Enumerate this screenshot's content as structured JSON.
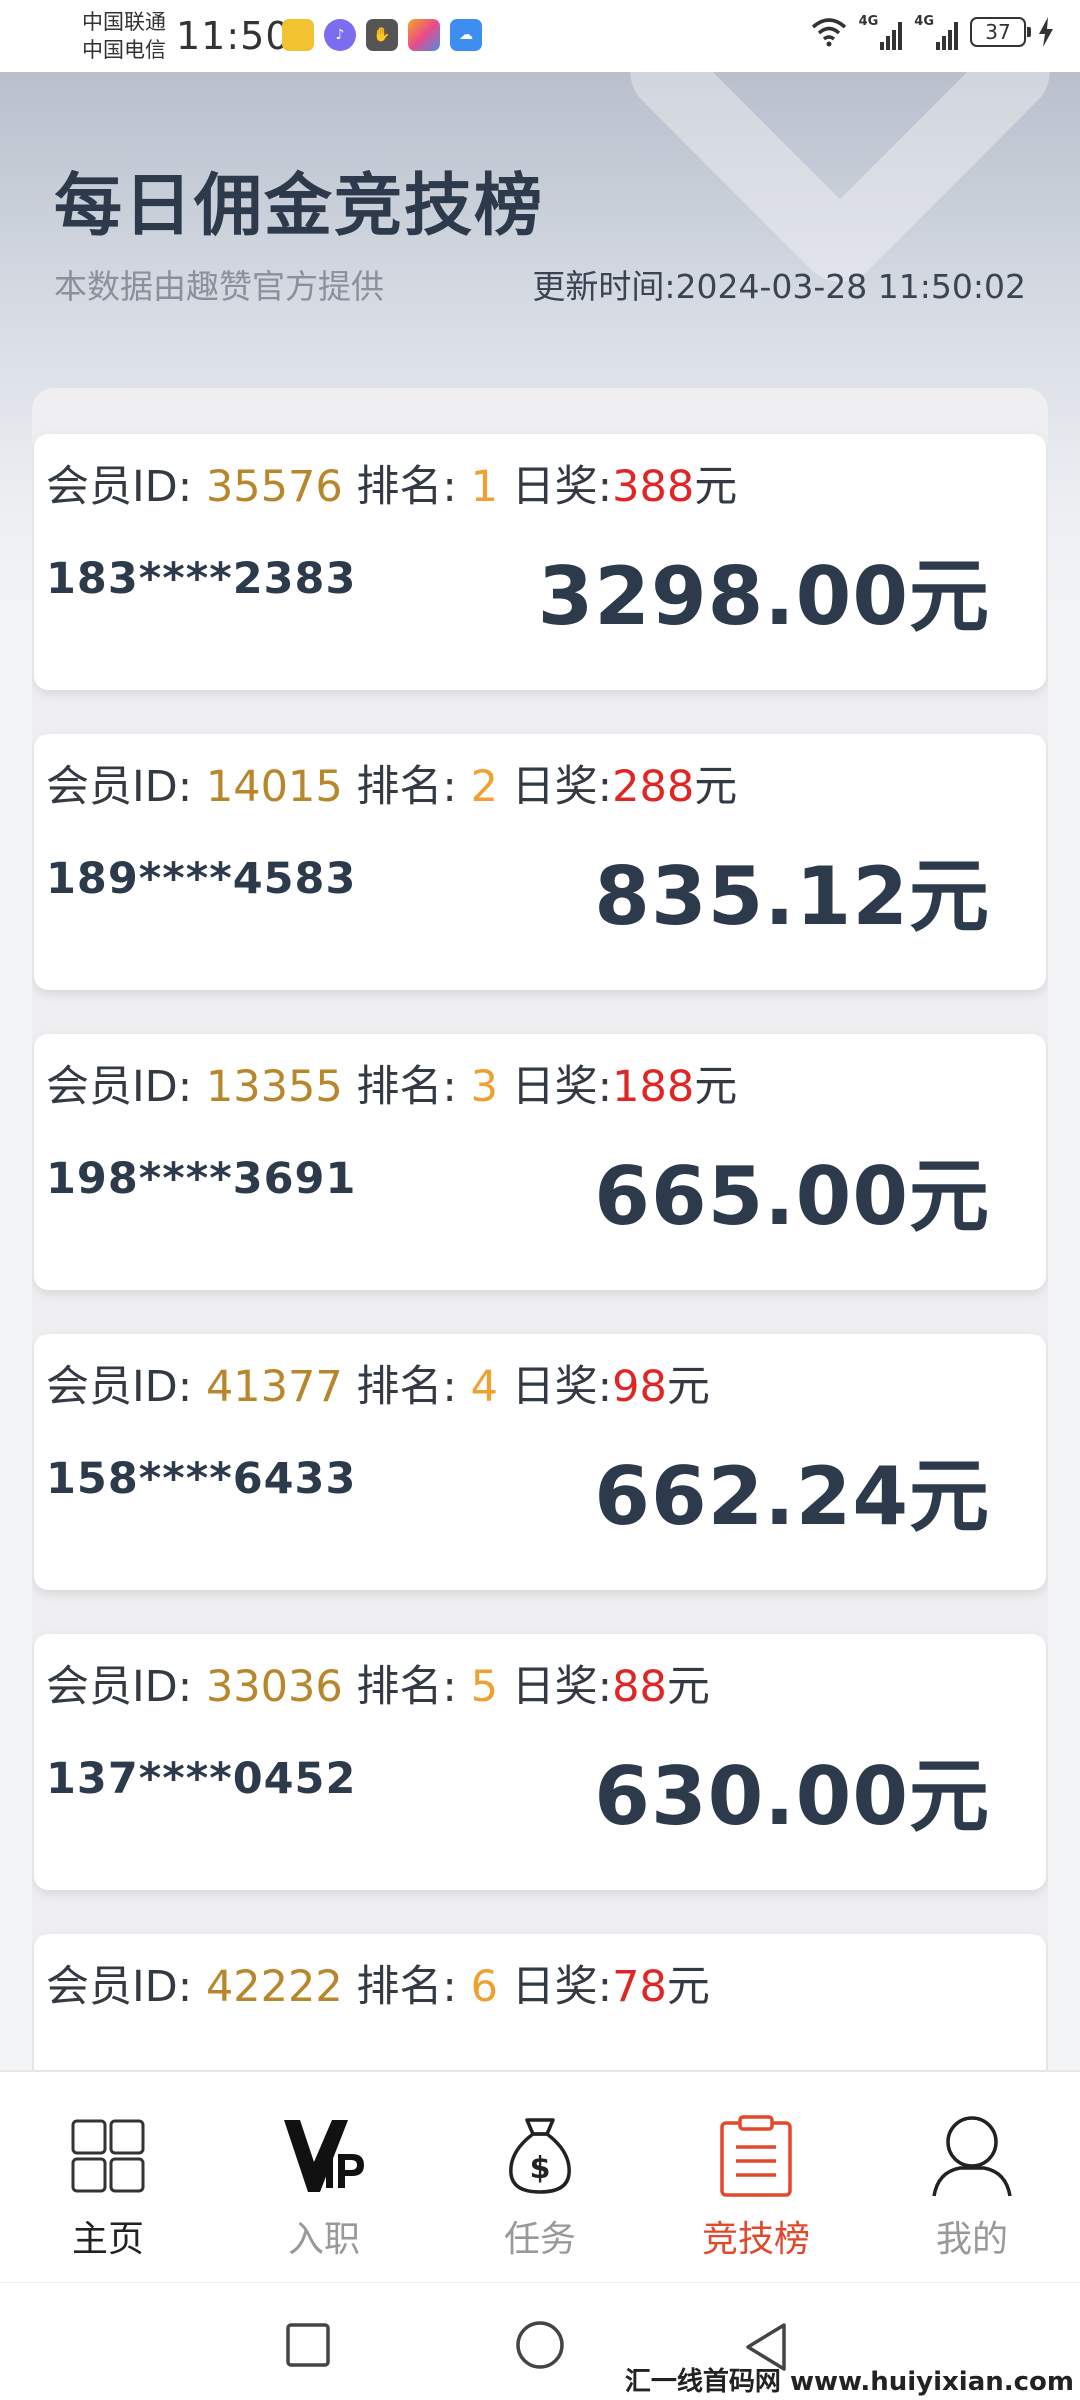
{
  "status_bar": {
    "carrier1": "中国联通",
    "carrier2": "中国电信",
    "time": "11:50",
    "net1": "4G",
    "net2": "4G",
    "battery": "37"
  },
  "header": {
    "title": "每日佣金竞技榜",
    "subtitle": "本数据由趣赞官方提供",
    "update_time": "更新时间:2024-03-28 11:50:02"
  },
  "labels": {
    "member_id": "会员ID:",
    "rank": "排名:",
    "daily_prize": "日奖:",
    "yuan": "元"
  },
  "ranking": [
    {
      "member_id": "35576",
      "rank": "1",
      "prize": "388",
      "phone": "183****2383",
      "amount": "3298.00元"
    },
    {
      "member_id": "14015",
      "rank": "2",
      "prize": "288",
      "phone": "189****4583",
      "amount": "835.12元"
    },
    {
      "member_id": "13355",
      "rank": "3",
      "prize": "188",
      "phone": "198****3691",
      "amount": "665.00元"
    },
    {
      "member_id": "41377",
      "rank": "4",
      "prize": "98",
      "phone": "158****6433",
      "amount": "662.24元"
    },
    {
      "member_id": "33036",
      "rank": "5",
      "prize": "88",
      "phone": "137****0452",
      "amount": "630.00元"
    },
    {
      "member_id": "42222",
      "rank": "6",
      "prize": "78",
      "phone": "",
      "amount": ""
    }
  ],
  "nav": [
    {
      "label": "主页",
      "icon": "grid-icon"
    },
    {
      "label": "入职",
      "icon": "vip-icon"
    },
    {
      "label": "任务",
      "icon": "money-bag-icon"
    },
    {
      "label": "竞技榜",
      "icon": "clipboard-icon"
    },
    {
      "label": "我的",
      "icon": "user-icon"
    }
  ],
  "watermark": "汇一线首码网 www.huiyixian.com",
  "colors": {
    "accent": "#e2492c",
    "member_id": "#b8862b",
    "rank": "#f0a030",
    "prize": "#e02525",
    "text_dark": "#2d3a4b"
  }
}
